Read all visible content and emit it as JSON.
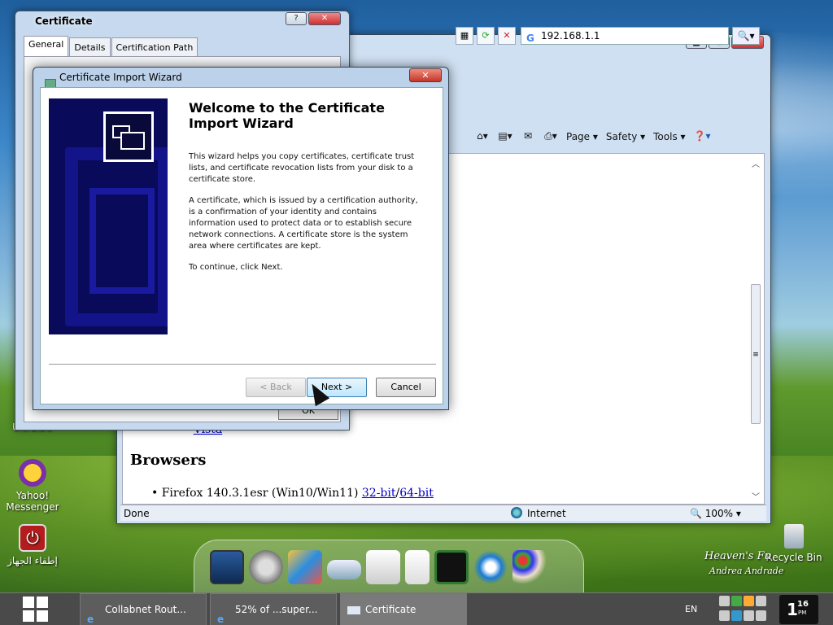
{
  "desktop": {
    "icons": [
      {
        "label": "Yahoo!\nMessenger"
      },
      {
        "label": "إطفاء الجهاز"
      },
      {
        "label": "Recycle Bin"
      },
      {
        "label": "UltraISO"
      }
    ],
    "watermark_line1": "Heaven's Fu",
    "watermark_line2": "Andrea Andrade"
  },
  "ie": {
    "address": "192.168.1.1",
    "address_prefix": "G",
    "commands": [
      "Page",
      "Safety",
      "Tools"
    ],
    "page": {
      "link_vista": "Vista",
      "heading": "Browsers",
      "firefox_prefix": "Firefox 140.3.1esr (Win10/Win11) ",
      "link_32": "32-bit",
      "sep": "/",
      "link_64": "64-bit"
    },
    "status": {
      "done": "Done",
      "zone": "Internet",
      "zoom": "100%"
    }
  },
  "cert": {
    "title": "Certificate",
    "tabs": [
      "General",
      "Details",
      "Certification Path"
    ],
    "ok": "OK"
  },
  "wizard": {
    "title": "Certificate Import Wizard",
    "heading": "Welcome to the Certificate Import Wizard",
    "p1": "This wizard helps you copy certificates, certificate trust lists, and certificate revocation lists from your disk to a certificate store.",
    "p2": "A certificate, which is issued by a certification authority, is a confirmation of your identity and contains information used to protect data or to establish secure network connections. A certificate store is the system area where certificates are kept.",
    "p3": "To continue, click Next.",
    "back": "< Back",
    "next": "Next >",
    "cancel": "Cancel"
  },
  "taskbar": {
    "items": [
      "Collabnet Rout...",
      "52% of ...super...",
      "Certificate"
    ],
    "lang": "EN",
    "clock_hour": "1",
    "clock_min": "16",
    "clock_ampm": "PM"
  },
  "colors": {
    "wizard_art_bg": "#0a0a5a",
    "link": "#0000cc",
    "taskbar": "#4a4a4a"
  }
}
